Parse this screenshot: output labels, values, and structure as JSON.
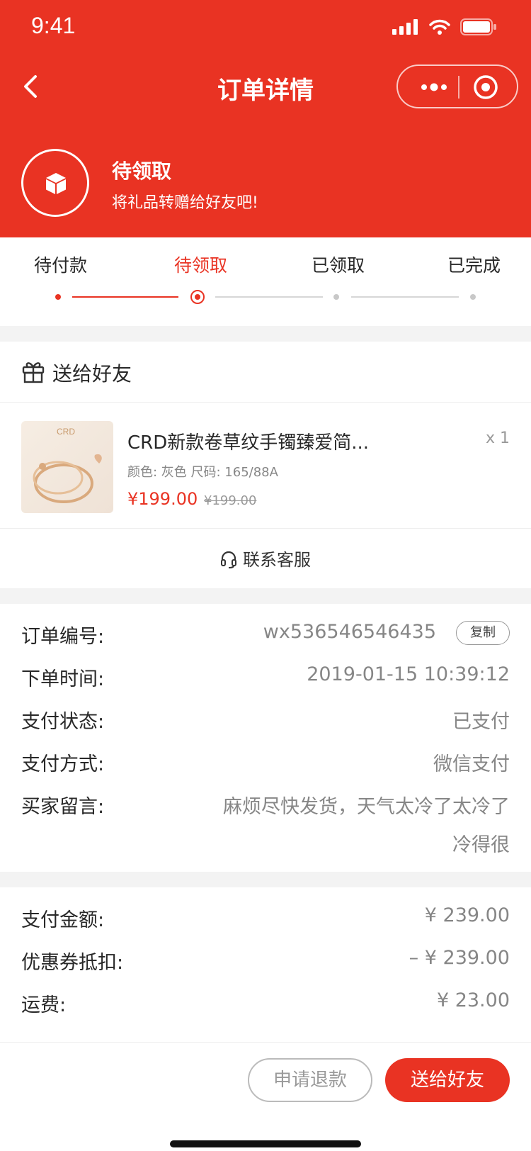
{
  "status_bar": {
    "time": "9:41"
  },
  "nav": {
    "title": "订单详情"
  },
  "order_status": {
    "title": "待领取",
    "subtitle": "将礼品转赠给好友吧!"
  },
  "progress": {
    "steps": [
      "待付款",
      "待领取",
      "已领取",
      "已完成"
    ],
    "current_index": 1
  },
  "gift_section": {
    "title": "送给好友"
  },
  "product": {
    "name": "CRD新款卷草纹手镯臻爱简...",
    "quantity": "x 1",
    "attrs": "颜色: 灰色  尺码: 165/88A",
    "price": "¥199.00",
    "original_price": "¥199.00",
    "thumb_brand": "CRD"
  },
  "service": {
    "label": "联系客服"
  },
  "order_info": {
    "order_no_label": "订单编号:",
    "order_no": "wx536546546435",
    "copy_label": "复制",
    "time_label": "下单时间:",
    "time": "2019-01-15 10:39:12",
    "pay_status_label": "支付状态:",
    "pay_status": "已支付",
    "pay_method_label": "支付方式:",
    "pay_method": "微信支付",
    "remark_label": "买家留言:",
    "remark_line1": "麻烦尽快发货，天气太冷了太冷了",
    "remark_line2": "冷得很"
  },
  "amounts": {
    "paid_label": "支付金额:",
    "paid": "¥ 239.00",
    "coupon_label": "优惠券抵扣:",
    "coupon": "– ¥ 239.00",
    "freight_label": "运费:",
    "freight": "¥ 23.00"
  },
  "footer": {
    "refund_label": "申请退款",
    "send_label": "送给好友"
  },
  "colors": {
    "accent": "#e93323",
    "background": "#f3f3f3"
  }
}
